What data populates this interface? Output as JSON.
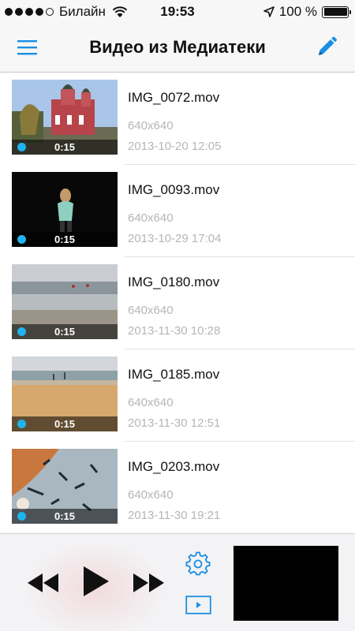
{
  "status_bar": {
    "carrier": "Билайн",
    "time": "19:53",
    "battery": "100 %",
    "battery_level": 1.0,
    "signal_bars_filled": 4,
    "signal_bars_total": 5
  },
  "nav": {
    "title": "Видео из Медиатеки",
    "menu_icon": "hamburger-icon",
    "edit_icon": "pencil-icon",
    "accent_color": "#1a8fe3"
  },
  "videos": [
    {
      "name": "IMG_0072.mov",
      "resolution": "640x640",
      "date": "2013-10-20 12:05",
      "duration": "0:15"
    },
    {
      "name": "IMG_0093.mov",
      "resolution": "640x640",
      "date": "2013-10-29 17:04",
      "duration": "0:15"
    },
    {
      "name": "IMG_0180.mov",
      "resolution": "640x640",
      "date": "2013-11-30 10:28",
      "duration": "0:15"
    },
    {
      "name": "IMG_0185.mov",
      "resolution": "640x640",
      "date": "2013-11-30 12:51",
      "duration": "0:15"
    },
    {
      "name": "IMG_0203.mov",
      "resolution": "640x640",
      "date": "2013-11-30 19:21",
      "duration": "0:15"
    }
  ],
  "player": {
    "rewind_icon": "rewind-icon",
    "play_icon": "play-icon",
    "forward_icon": "fast-forward-icon",
    "settings_icon": "gear-icon",
    "screen_icon": "screen-play-icon",
    "dot_color": "#1fb3f0"
  }
}
